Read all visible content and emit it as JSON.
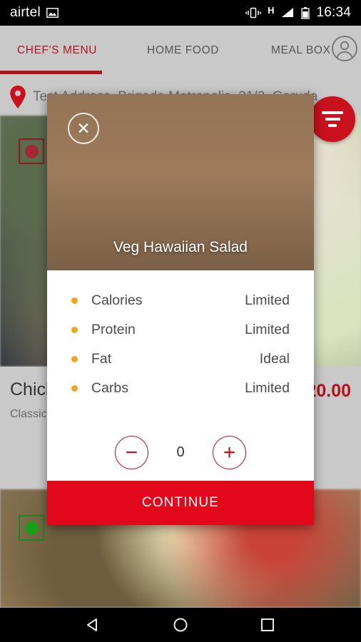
{
  "status_bar": {
    "carrier": "airtel",
    "network_type": "H",
    "time": "16:34",
    "icons": [
      "image-icon",
      "vibrate-icon",
      "network-type-h",
      "signal-icon",
      "battery-icon"
    ]
  },
  "header": {
    "tabs": [
      {
        "label": "CHEF'S MENU",
        "active": true
      },
      {
        "label": "HOME FOOD",
        "active": false
      },
      {
        "label": "MEAL BOX",
        "active": false
      }
    ],
    "account_icon": "account-circle-icon",
    "accent_color": "#b3121c"
  },
  "address": {
    "pin_icon": "location-pin-icon",
    "text": "Test Address, Brigade Metropolis, 21/2, Garuda"
  },
  "filter_fab": {
    "icon": "filter-icon",
    "color": "#c8111d"
  },
  "background_list": {
    "items": [
      {
        "diet_badge": "non-veg-indicator",
        "title": "Chicken",
        "subtitle": "Classic",
        "price": "20.00"
      },
      {
        "diet_badge": "veg-indicator"
      }
    ]
  },
  "modal": {
    "close_icon": "close-icon",
    "title": "Veg Hawaiian Salad",
    "nutrition": [
      {
        "label": "Calories",
        "value": "Limited"
      },
      {
        "label": "Protein",
        "value": "Limited"
      },
      {
        "label": "Fat",
        "value": "Ideal"
      },
      {
        "label": "Carbs",
        "value": "Limited"
      }
    ],
    "bullet_color": "#f0a623",
    "stepper": {
      "decrement_label": "−",
      "quantity": "0",
      "increment_label": "+"
    },
    "continue_label": "CONTINUE",
    "continue_color": "#e2071b"
  },
  "nav_bar": {
    "back": "back-icon",
    "home": "home-icon",
    "recents": "recents-icon"
  }
}
